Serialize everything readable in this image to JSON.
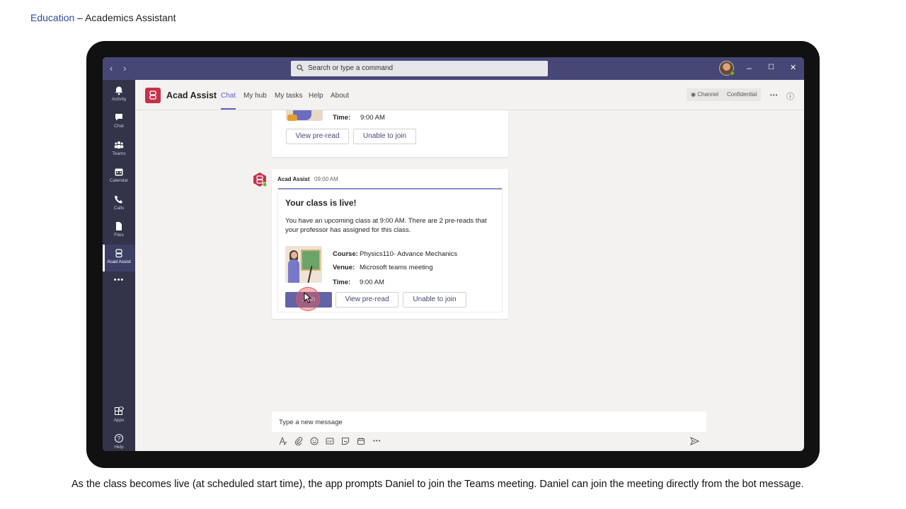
{
  "slide": {
    "breadcrumb": "Education",
    "separator": "–",
    "title": "Academics Assistant",
    "caption": "As the class becomes live (at scheduled start time), the app prompts Daniel to join the Teams meeting. Daniel can join the meeting directly from the bot message."
  },
  "titlebar": {
    "back": "‹",
    "forward": "›",
    "search_placeholder": "Search or type a command",
    "min": "–",
    "max": "☐",
    "close": "✕"
  },
  "rail": {
    "items": [
      {
        "label": "Activity",
        "icon": "bell-icon"
      },
      {
        "label": "Chat",
        "icon": "chat-icon"
      },
      {
        "label": "Teams",
        "icon": "teams-icon"
      },
      {
        "label": "Calendar",
        "icon": "calendar-icon"
      },
      {
        "label": "Calls",
        "icon": "phone-icon"
      },
      {
        "label": "Files",
        "icon": "file-icon"
      },
      {
        "label": "Acad Assist",
        "icon": "bot-icon"
      }
    ],
    "more": "•••",
    "bottom": [
      {
        "label": "Apps",
        "icon": "apps-icon"
      },
      {
        "label": "Help",
        "icon": "help-icon"
      }
    ]
  },
  "app_header": {
    "name": "Acad Assist",
    "tabs": [
      "Chat",
      "My hub",
      "My tasks",
      "Help",
      "About"
    ],
    "active_tab": "Chat",
    "channel": "Channel",
    "confidential": "Confidential",
    "more": "•••",
    "info": "ⓘ"
  },
  "prev_card": {
    "time_label": "Time:",
    "time_value": "9:00 AM",
    "view_preread": "View pre-read",
    "unable": "Unable to join"
  },
  "message": {
    "sender": "Acad Assist",
    "timestamp": "09:00 AM",
    "title": "Your class is live!",
    "body": "You have an upcoming class at 9:00 AM. There are 2 pre-reads that your professor has assigned for this class.",
    "course_label": "Course:",
    "course_value": "Physics110- Advance Mechanics",
    "venue_label": "Venue:",
    "venue_value": "Microsoft teams meeting",
    "time_label": "Time:",
    "time_value": "9:00 AM",
    "join": "Join",
    "view_preread": "View pre-read",
    "unable": "Unable to join"
  },
  "composer": {
    "placeholder": "Type a new message",
    "more": "•••"
  },
  "colors": {
    "titlebar": "#464775",
    "rail": "#33344a",
    "accent": "#6264a7",
    "brand_red": "#c4314b"
  }
}
